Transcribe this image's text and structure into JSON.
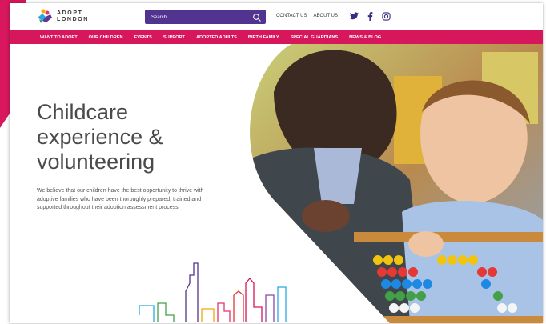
{
  "header": {
    "logo_line1": "ADOPT",
    "logo_line2": "LONDON",
    "search_placeholder": "Search",
    "top_links": [
      "CONTACT US",
      "ABOUT US"
    ],
    "social_icons": [
      "twitter-icon",
      "facebook-icon",
      "instagram-icon"
    ]
  },
  "nav": {
    "items": [
      "WANT TO ADOPT",
      "OUR CHILDREN",
      "EVENTS",
      "SUPPORT",
      "ADOPTED ADULTS",
      "BIRTH FAMILY",
      "SPECIAL GUARDIANS",
      "NEWS & BLOG"
    ]
  },
  "hero": {
    "title_line1": "Childcare",
    "title_line2": "experience &",
    "title_line3": "volunteering",
    "body": "We believe that our children have the best opportunity to thrive with adoptive families who have been thoroughly prepared, trained and supported throughout their adoption assessment process."
  },
  "colors": {
    "brand_magenta": "#d6175c",
    "search_purple": "#51348f",
    "title_gray": "#4a4a4a"
  }
}
